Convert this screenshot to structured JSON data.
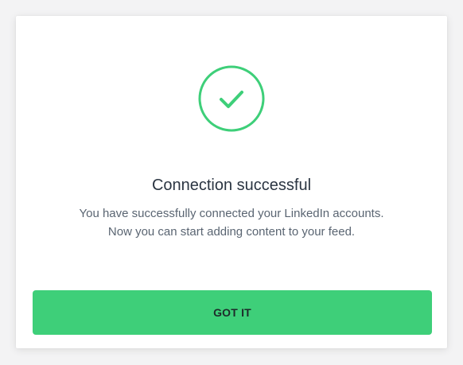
{
  "dialog": {
    "icon": "checkmark-circle-icon",
    "title": "Connection successful",
    "message_lines": [
      "You have successfully connected your LinkedIn accounts.",
      "Now you can start adding content to your feed."
    ],
    "button_label": "GOT IT"
  },
  "colors": {
    "accent": "#3ecf79",
    "title_text": "#2b3542",
    "body_text": "#5a6572",
    "background": "#f3f3f4"
  }
}
